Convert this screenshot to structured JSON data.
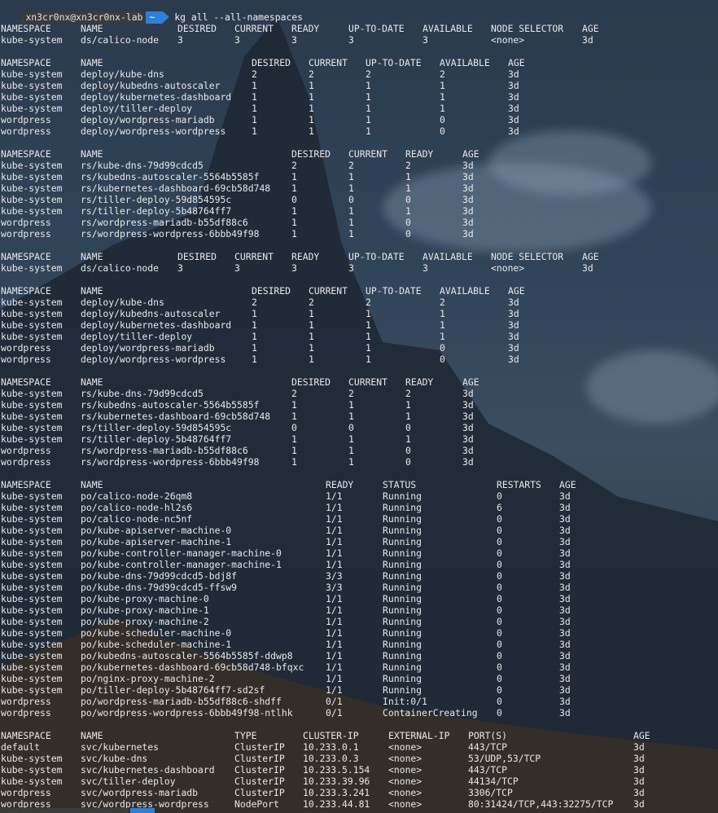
{
  "prompt": {
    "user_host": "xn3cr0nx@xn3cr0nx-lab",
    "path": "~",
    "command": "kg all --all-namespaces"
  },
  "blocks": [
    {
      "headers": [
        "NAMESPACE",
        "NAME",
        "DESIRED",
        "CURRENT",
        "READY",
        "UP-TO-DATE",
        "AVAILABLE",
        "NODE SELECTOR",
        "AGE"
      ],
      "rows": [
        [
          "kube-system",
          "ds/calico-node",
          "3",
          "3",
          "3",
          "3",
          "3",
          "<none>",
          "3d"
        ]
      ]
    },
    {
      "headers": [
        "NAMESPACE",
        "NAME",
        "DESIRED",
        "CURRENT",
        "UP-TO-DATE",
        "AVAILABLE",
        "AGE"
      ],
      "rows": [
        [
          "kube-system",
          "deploy/kube-dns",
          "2",
          "2",
          "2",
          "2",
          "3d"
        ],
        [
          "kube-system",
          "deploy/kubedns-autoscaler",
          "1",
          "1",
          "1",
          "1",
          "3d"
        ],
        [
          "kube-system",
          "deploy/kubernetes-dashboard",
          "1",
          "1",
          "1",
          "1",
          "3d"
        ],
        [
          "kube-system",
          "deploy/tiller-deploy",
          "1",
          "1",
          "1",
          "1",
          "3d"
        ],
        [
          "wordpress",
          "deploy/wordpress-mariadb",
          "1",
          "1",
          "1",
          "0",
          "3d"
        ],
        [
          "wordpress",
          "deploy/wordpress-wordpress",
          "1",
          "1",
          "1",
          "0",
          "3d"
        ]
      ]
    },
    {
      "headers": [
        "NAMESPACE",
        "NAME",
        "DESIRED",
        "CURRENT",
        "READY",
        "AGE"
      ],
      "rows": [
        [
          "kube-system",
          "rs/kube-dns-79d99cdcd5",
          "2",
          "2",
          "2",
          "3d"
        ],
        [
          "kube-system",
          "rs/kubedns-autoscaler-5564b5585f",
          "1",
          "1",
          "1",
          "3d"
        ],
        [
          "kube-system",
          "rs/kubernetes-dashboard-69cb58d748",
          "1",
          "1",
          "1",
          "3d"
        ],
        [
          "kube-system",
          "rs/tiller-deploy-59d854595c",
          "0",
          "0",
          "0",
          "3d"
        ],
        [
          "kube-system",
          "rs/tiller-deploy-5b48764ff7",
          "1",
          "1",
          "1",
          "3d"
        ],
        [
          "wordpress",
          "rs/wordpress-mariadb-b55df88c6",
          "1",
          "1",
          "0",
          "3d"
        ],
        [
          "wordpress",
          "rs/wordpress-wordpress-6bbb49f98",
          "1",
          "1",
          "0",
          "3d"
        ]
      ]
    },
    {
      "headers": [
        "NAMESPACE",
        "NAME",
        "DESIRED",
        "CURRENT",
        "READY",
        "UP-TO-DATE",
        "AVAILABLE",
        "NODE SELECTOR",
        "AGE"
      ],
      "rows": [
        [
          "kube-system",
          "ds/calico-node",
          "3",
          "3",
          "3",
          "3",
          "3",
          "<none>",
          "3d"
        ]
      ]
    },
    {
      "headers": [
        "NAMESPACE",
        "NAME",
        "DESIRED",
        "CURRENT",
        "UP-TO-DATE",
        "AVAILABLE",
        "AGE"
      ],
      "rows": [
        [
          "kube-system",
          "deploy/kube-dns",
          "2",
          "2",
          "2",
          "2",
          "3d"
        ],
        [
          "kube-system",
          "deploy/kubedns-autoscaler",
          "1",
          "1",
          "1",
          "1",
          "3d"
        ],
        [
          "kube-system",
          "deploy/kubernetes-dashboard",
          "1",
          "1",
          "1",
          "1",
          "3d"
        ],
        [
          "kube-system",
          "deploy/tiller-deploy",
          "1",
          "1",
          "1",
          "1",
          "3d"
        ],
        [
          "wordpress",
          "deploy/wordpress-mariadb",
          "1",
          "1",
          "1",
          "0",
          "3d"
        ],
        [
          "wordpress",
          "deploy/wordpress-wordpress",
          "1",
          "1",
          "1",
          "0",
          "3d"
        ]
      ]
    },
    {
      "headers": [
        "NAMESPACE",
        "NAME",
        "DESIRED",
        "CURRENT",
        "READY",
        "AGE"
      ],
      "rows": [
        [
          "kube-system",
          "rs/kube-dns-79d99cdcd5",
          "2",
          "2",
          "2",
          "3d"
        ],
        [
          "kube-system",
          "rs/kubedns-autoscaler-5564b5585f",
          "1",
          "1",
          "1",
          "3d"
        ],
        [
          "kube-system",
          "rs/kubernetes-dashboard-69cb58d748",
          "1",
          "1",
          "1",
          "3d"
        ],
        [
          "kube-system",
          "rs/tiller-deploy-59d854595c",
          "0",
          "0",
          "0",
          "3d"
        ],
        [
          "kube-system",
          "rs/tiller-deploy-5b48764ff7",
          "1",
          "1",
          "1",
          "3d"
        ],
        [
          "wordpress",
          "rs/wordpress-mariadb-b55df88c6",
          "1",
          "1",
          "0",
          "3d"
        ],
        [
          "wordpress",
          "rs/wordpress-wordpress-6bbb49f98",
          "1",
          "1",
          "0",
          "3d"
        ]
      ]
    },
    {
      "headers": [
        "NAMESPACE",
        "NAME",
        "READY",
        "STATUS",
        "RESTARTS",
        "AGE"
      ],
      "rows": [
        [
          "kube-system",
          "po/calico-node-26qm8",
          "1/1",
          "Running",
          "0",
          "3d"
        ],
        [
          "kube-system",
          "po/calico-node-hl2s6",
          "1/1",
          "Running",
          "6",
          "3d"
        ],
        [
          "kube-system",
          "po/calico-node-nc5nf",
          "1/1",
          "Running",
          "0",
          "3d"
        ],
        [
          "kube-system",
          "po/kube-apiserver-machine-0",
          "1/1",
          "Running",
          "0",
          "3d"
        ],
        [
          "kube-system",
          "po/kube-apiserver-machine-1",
          "1/1",
          "Running",
          "0",
          "3d"
        ],
        [
          "kube-system",
          "po/kube-controller-manager-machine-0",
          "1/1",
          "Running",
          "0",
          "3d"
        ],
        [
          "kube-system",
          "po/kube-controller-manager-machine-1",
          "1/1",
          "Running",
          "0",
          "3d"
        ],
        [
          "kube-system",
          "po/kube-dns-79d99cdcd5-bdj8f",
          "3/3",
          "Running",
          "0",
          "3d"
        ],
        [
          "kube-system",
          "po/kube-dns-79d99cdcd5-ffsw9",
          "3/3",
          "Running",
          "0",
          "3d"
        ],
        [
          "kube-system",
          "po/kube-proxy-machine-0",
          "1/1",
          "Running",
          "0",
          "3d"
        ],
        [
          "kube-system",
          "po/kube-proxy-machine-1",
          "1/1",
          "Running",
          "0",
          "3d"
        ],
        [
          "kube-system",
          "po/kube-proxy-machine-2",
          "1/1",
          "Running",
          "0",
          "3d"
        ],
        [
          "kube-system",
          "po/kube-scheduler-machine-0",
          "1/1",
          "Running",
          "0",
          "3d"
        ],
        [
          "kube-system",
          "po/kube-scheduler-machine-1",
          "1/1",
          "Running",
          "0",
          "3d"
        ],
        [
          "kube-system",
          "po/kubedns-autoscaler-5564b5585f-ddwp8",
          "1/1",
          "Running",
          "0",
          "3d"
        ],
        [
          "kube-system",
          "po/kubernetes-dashboard-69cb58d748-bfqxc",
          "1/1",
          "Running",
          "0",
          "3d"
        ],
        [
          "kube-system",
          "po/nginx-proxy-machine-2",
          "1/1",
          "Running",
          "0",
          "3d"
        ],
        [
          "kube-system",
          "po/tiller-deploy-5b48764ff7-sd2sf",
          "1/1",
          "Running",
          "0",
          "3d"
        ],
        [
          "wordpress",
          "po/wordpress-mariadb-b55df88c6-shdff",
          "0/1",
          "Init:0/1",
          "0",
          "3d"
        ],
        [
          "wordpress",
          "po/wordpress-wordpress-6bbb49f98-ntlhk",
          "0/1",
          "ContainerCreating",
          "0",
          "3d"
        ]
      ]
    },
    {
      "headers": [
        "NAMESPACE",
        "NAME",
        "TYPE",
        "CLUSTER-IP",
        "EXTERNAL-IP",
        "PORT(S)",
        "AGE"
      ],
      "rows": [
        [
          "default",
          "svc/kubernetes",
          "ClusterIP",
          "10.233.0.1",
          "<none>",
          "443/TCP",
          "3d"
        ],
        [
          "kube-system",
          "svc/kube-dns",
          "ClusterIP",
          "10.233.0.3",
          "<none>",
          "53/UDP,53/TCP",
          "3d"
        ],
        [
          "kube-system",
          "svc/kubernetes-dashboard",
          "ClusterIP",
          "10.233.5.154",
          "<none>",
          "443/TCP",
          "3d"
        ],
        [
          "kube-system",
          "svc/tiller-deploy",
          "ClusterIP",
          "10.233.39.96",
          "<none>",
          "44134/TCP",
          "3d"
        ],
        [
          "wordpress",
          "svc/wordpress-mariadb",
          "ClusterIP",
          "10.233.3.241",
          "<none>",
          "3306/TCP",
          "3d"
        ],
        [
          "wordpress",
          "svc/wordpress-wordpress",
          "NodePort",
          "10.233.44.81",
          "<none>",
          "80:31424/TCP,443:32275/TCP",
          "3d"
        ]
      ]
    }
  ]
}
